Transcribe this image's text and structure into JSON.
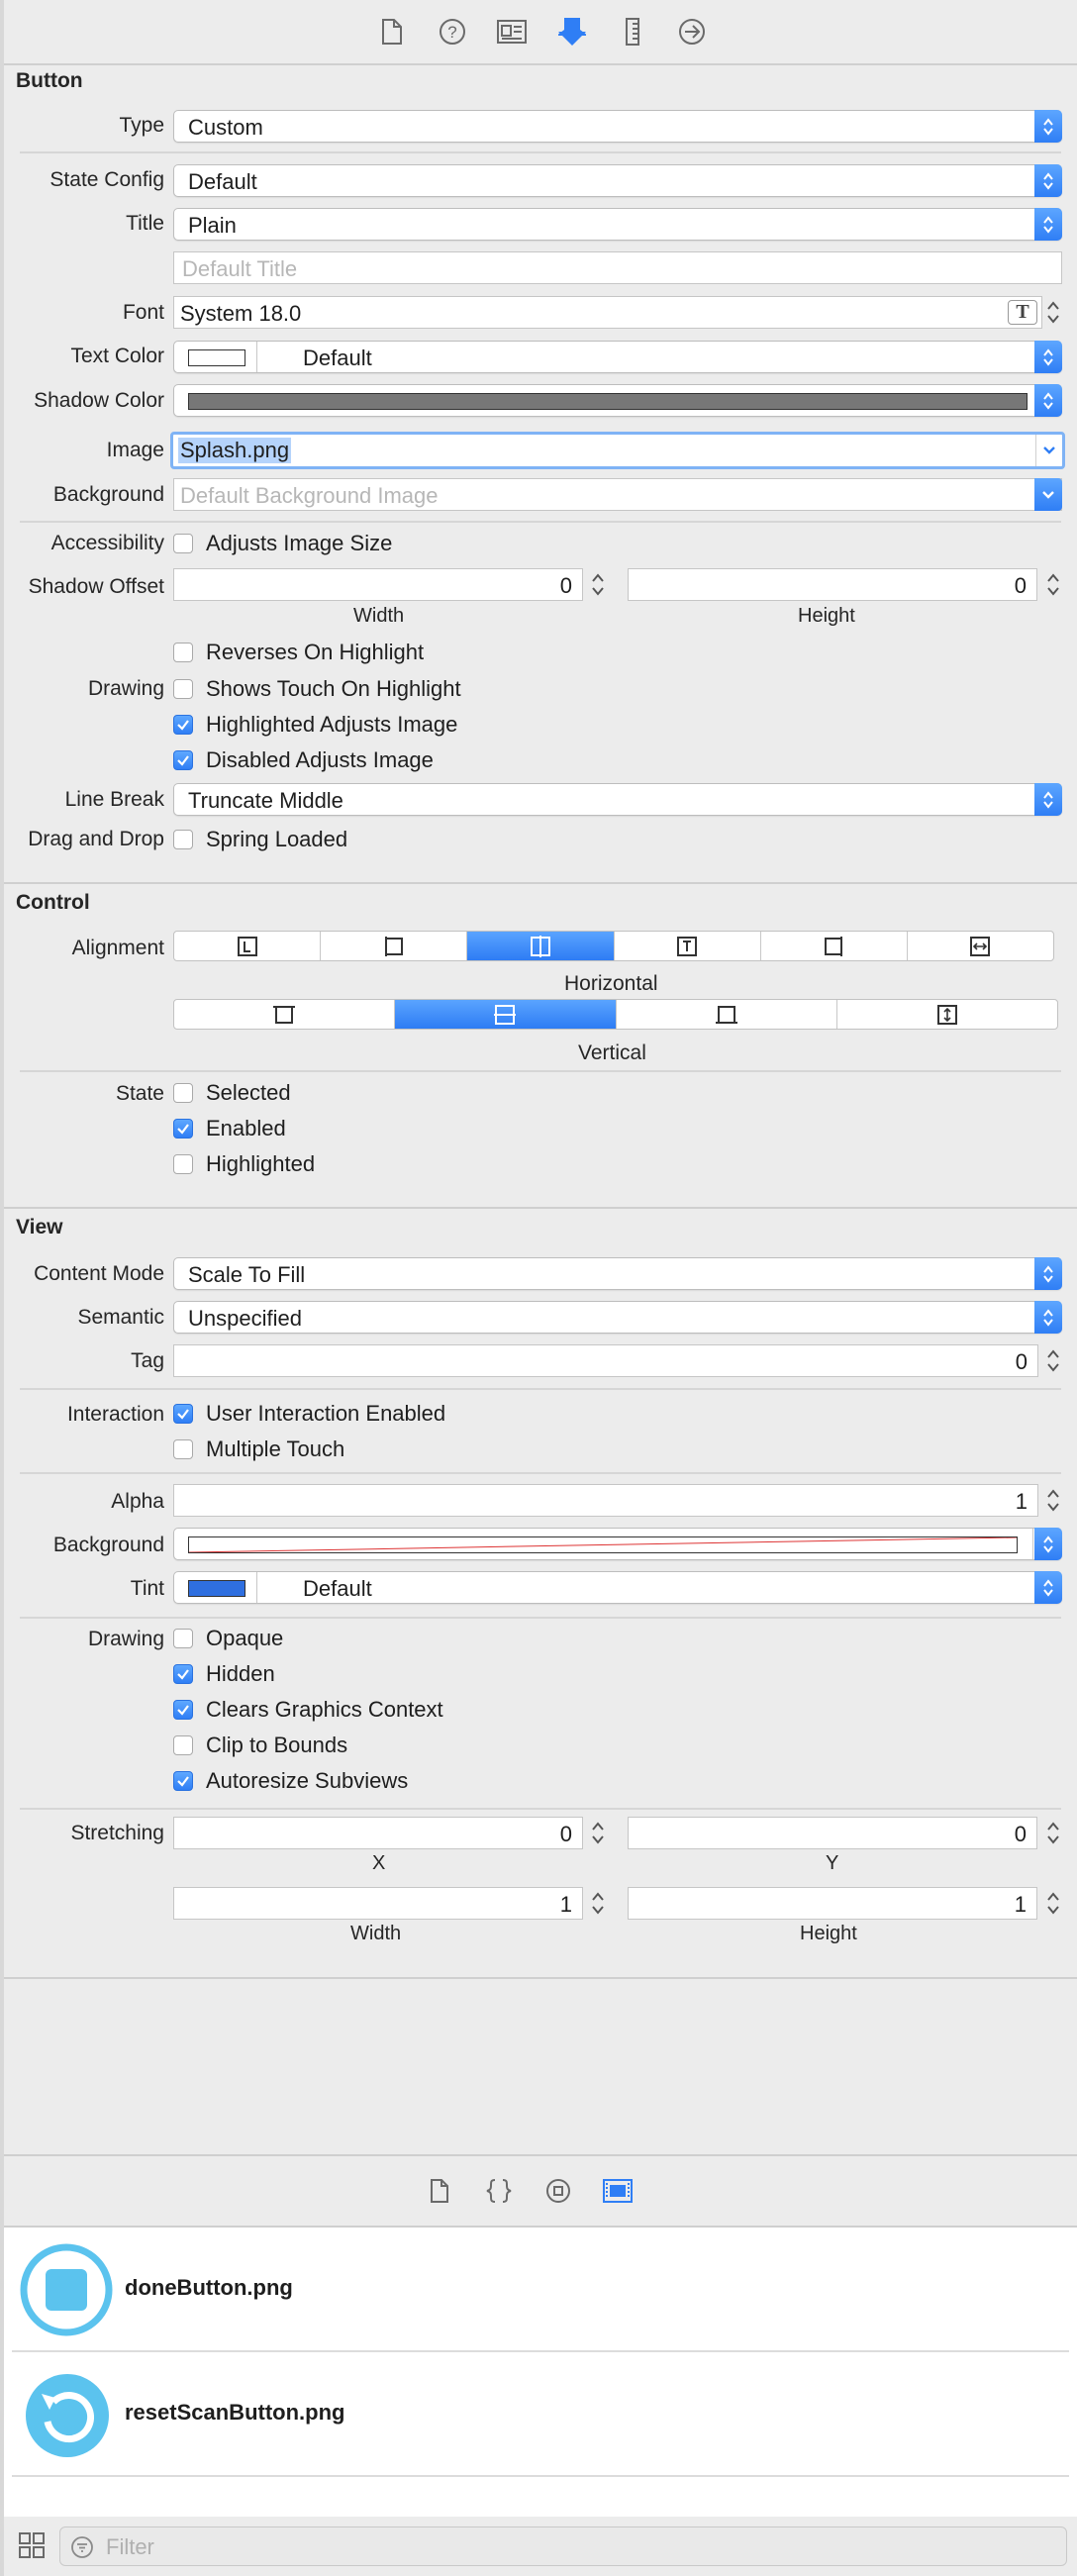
{
  "toolbar": {
    "icons": [
      "file-icon",
      "help-icon",
      "identity-icon",
      "attributes-icon",
      "size-ruler-icon",
      "connections-icon"
    ]
  },
  "button_section": {
    "title": "Button",
    "type": {
      "label": "Type",
      "value": "Custom"
    },
    "state_config": {
      "label": "State Config",
      "value": "Default"
    },
    "title_field": {
      "label": "Title",
      "value": "Plain"
    },
    "default_title_placeholder": "Default Title",
    "font": {
      "label": "Font",
      "value": "System 18.0"
    },
    "text_color": {
      "label": "Text Color",
      "value": "Default"
    },
    "shadow_color": {
      "label": "Shadow Color"
    },
    "image": {
      "label": "Image",
      "value": "Splash.png"
    },
    "background": {
      "label": "Background",
      "placeholder": "Default Background Image"
    },
    "accessibility": {
      "label": "Accessibility",
      "option": "Adjusts Image Size",
      "checked": false
    },
    "shadow_offset": {
      "label": "Shadow Offset",
      "width": "0",
      "height": "0",
      "width_label": "Width",
      "height_label": "Height"
    },
    "drawing": {
      "label": "Drawing",
      "options": [
        {
          "text": "Reverses On Highlight",
          "checked": false
        },
        {
          "text": "Shows Touch On Highlight",
          "checked": false
        },
        {
          "text": "Highlighted Adjusts Image",
          "checked": true
        },
        {
          "text": "Disabled Adjusts Image",
          "checked": true
        }
      ]
    },
    "line_break": {
      "label": "Line Break",
      "value": "Truncate Middle"
    },
    "drag_drop": {
      "label": "Drag and Drop",
      "option": "Spring Loaded",
      "checked": false
    }
  },
  "control_section": {
    "title": "Control",
    "alignment_label": "Alignment",
    "horizontal_label": "Horizontal",
    "vertical_label": "Vertical",
    "horizontal_selected_index": 2,
    "vertical_selected_index": 1,
    "state": {
      "label": "State",
      "options": [
        {
          "text": "Selected",
          "checked": false
        },
        {
          "text": "Enabled",
          "checked": true
        },
        {
          "text": "Highlighted",
          "checked": false
        }
      ]
    }
  },
  "view_section": {
    "title": "View",
    "content_mode": {
      "label": "Content Mode",
      "value": "Scale To Fill"
    },
    "semantic": {
      "label": "Semantic",
      "value": "Unspecified"
    },
    "tag": {
      "label": "Tag",
      "value": "0"
    },
    "interaction": {
      "label": "Interaction",
      "options": [
        {
          "text": "User Interaction Enabled",
          "checked": true
        },
        {
          "text": "Multiple Touch",
          "checked": false
        }
      ]
    },
    "alpha": {
      "label": "Alpha",
      "value": "1"
    },
    "background": {
      "label": "Background"
    },
    "tint": {
      "label": "Tint",
      "value": "Default",
      "color": "#2f6fe0"
    },
    "drawing": {
      "label": "Drawing",
      "options": [
        {
          "text": "Opaque",
          "checked": false
        },
        {
          "text": "Hidden",
          "checked": true
        },
        {
          "text": "Clears Graphics Context",
          "checked": true
        },
        {
          "text": "Clip to Bounds",
          "checked": false
        },
        {
          "text": "Autoresize Subviews",
          "checked": true
        }
      ]
    },
    "stretching": {
      "label": "Stretching",
      "x": "0",
      "y": "0",
      "width": "1",
      "height": "1",
      "x_label": "X",
      "y_label": "Y",
      "width_label": "Width",
      "height_label": "Height"
    }
  },
  "library": {
    "tabs": [
      "file-template-icon",
      "code-snippet-icon",
      "object-library-icon",
      "media-library-icon"
    ],
    "items": [
      {
        "name": "doneButton.png",
        "icon": "done-button-thumbnail"
      },
      {
        "name": "resetScanButton.png",
        "icon": "reset-scan-button-thumbnail"
      }
    ]
  },
  "filter": {
    "placeholder": "Filter"
  },
  "colors": {
    "accent": "#2f7ef5",
    "thumb": "#5bc3ee"
  }
}
